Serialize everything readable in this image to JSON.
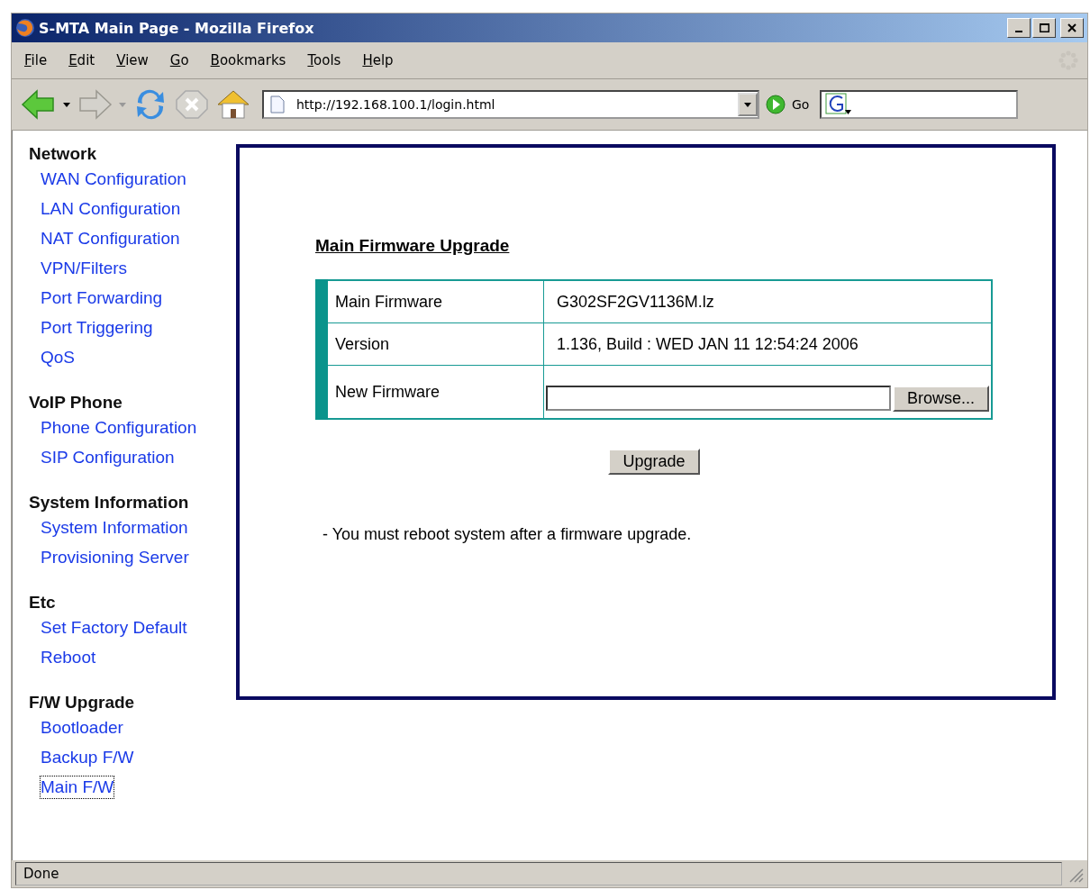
{
  "window": {
    "title": "S-MTA Main Page - Mozilla Firefox"
  },
  "menu": [
    "File",
    "Edit",
    "View",
    "Go",
    "Bookmarks",
    "Tools",
    "Help"
  ],
  "toolbar": {
    "url": "http://192.168.100.1/login.html",
    "go_label": "Go"
  },
  "sidebar": [
    {
      "heading": "Network",
      "items": [
        {
          "label": "WAN Configuration",
          "focused": false
        },
        {
          "label": "LAN Configuration",
          "focused": false
        },
        {
          "label": "NAT Configuration",
          "focused": false
        },
        {
          "label": "VPN/Filters",
          "focused": false
        },
        {
          "label": "Port Forwarding",
          "focused": false
        },
        {
          "label": "Port Triggering",
          "focused": false
        },
        {
          "label": "QoS",
          "focused": false
        }
      ]
    },
    {
      "heading": "VoIP Phone",
      "items": [
        {
          "label": "Phone Configuration",
          "focused": false
        },
        {
          "label": "SIP Configuration",
          "focused": false
        }
      ]
    },
    {
      "heading": "System Information",
      "items": [
        {
          "label": "System Information",
          "focused": false
        },
        {
          "label": "Provisioning Server",
          "focused": false
        }
      ]
    },
    {
      "heading": "Etc",
      "items": [
        {
          "label": "Set Factory Default",
          "focused": false
        },
        {
          "label": "Reboot",
          "focused": false
        }
      ]
    },
    {
      "heading": "F/W Upgrade",
      "items": [
        {
          "label": "Bootloader",
          "focused": false
        },
        {
          "label": "Backup F/W",
          "focused": false
        },
        {
          "label": "Main F/W",
          "focused": true
        }
      ]
    }
  ],
  "main": {
    "title": "Main Firmware Upgrade",
    "rows": [
      {
        "kind": "text",
        "label": "Main Firmware",
        "value": "G302SF2GV1136M.lz"
      },
      {
        "kind": "text",
        "label": "Version",
        "value": "1.136, Build : WED JAN 11 12:54:24 2006"
      },
      {
        "kind": "file",
        "label": "New Firmware",
        "button": "Browse..."
      }
    ],
    "upgrade_button": "Upgrade",
    "note": "- You must reboot system after a firmware upgrade."
  },
  "status_bar": {
    "text": "Done"
  }
}
